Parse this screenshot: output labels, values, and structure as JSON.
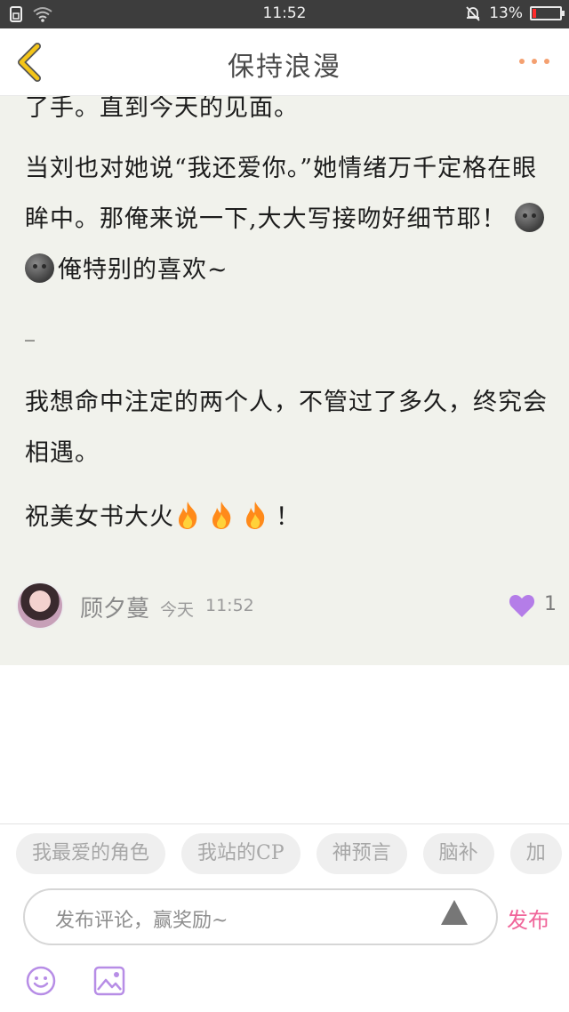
{
  "status_bar": {
    "time": "11:52",
    "battery_text": "13%",
    "battery_level": 0.13,
    "battery_color": "#ff2a2a"
  },
  "nav": {
    "title": "保持浪漫",
    "back_icon": "chevron-left-icon",
    "more_icon": "more-dots-icon",
    "accent": "#f4c518"
  },
  "content": {
    "paragraphs": [
      "了手。直到今天的见面。",
      "当刘也对她说“我还爱你。”她情绪万千定格在眼眸中。那俺来说一下,大大写接吻好细节耶！",
      "_",
      "我想命中注定的两个人，不管过了多久，终究会相遇。",
      "祝美女书大火"
    ],
    "p1_tail": "俺特别的喜欢~",
    "p4_tail": "！",
    "emoji_moon": "new-moon-face-icon",
    "emoji_fire": "fire-icon"
  },
  "comment": {
    "author": "顾夕蔓",
    "day": "今天",
    "time": "11:52",
    "likes": "1",
    "like_color": "#b47de8"
  },
  "bottom": {
    "tags": [
      "我最爱的角色",
      "我站的CP",
      "神预言",
      "脑补",
      "加"
    ],
    "input_placeholder": "发布评论，赢奖励~",
    "send_label": "发布",
    "send_color": "#f0659a"
  }
}
